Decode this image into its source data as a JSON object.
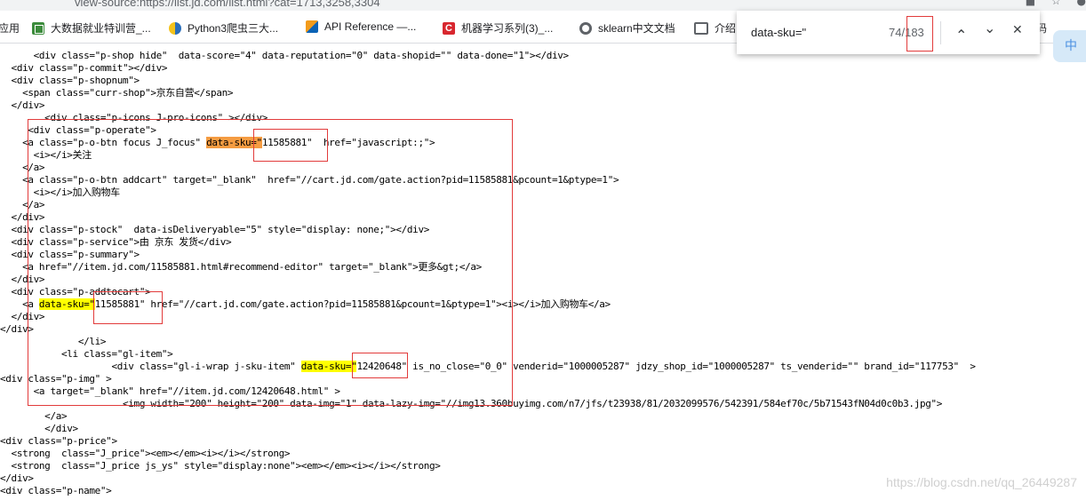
{
  "browser": {
    "url": "view-source:https://list.jd.com/list.html?cat=1713,3258,3304",
    "icons": {
      "extension": "extension-icon",
      "star": "star-icon",
      "profile": "profile-icon"
    }
  },
  "bookmarks": [
    {
      "label": "应用",
      "icon": "apps-icon"
    },
    {
      "label": "大数据就业特训营_...",
      "icon": "green-site-icon"
    },
    {
      "label": "Python3爬虫三大...",
      "icon": "python-icon"
    },
    {
      "label": "API Reference —...",
      "icon": "api-icon"
    },
    {
      "label": "机器学习系列(3)_...",
      "icon": "csdn-icon",
      "glyph": "C"
    },
    {
      "label": "sklearn中文文档",
      "icon": "globe-icon"
    },
    {
      "label": "介绍",
      "icon": "book-icon"
    }
  ],
  "bookmarks_tail": "码",
  "side_tab": "中",
  "find_bar": {
    "query": "data-sku=\"",
    "current": "74",
    "total": "183",
    "separator": "/",
    "prev_glyph": "⌃",
    "next_glyph": "⌄",
    "close_glyph": "✕"
  },
  "source_lines": [
    {
      "t": "      <div class=\"p-shop hide\"  data-score=\"4\" data-reputation=\"0\" data-shopid=\"\" data-done=\"1\"></div>"
    },
    {
      "t": "  <div class=\"p-commit\"></div>"
    },
    {
      "t": "  <div class=\"p-shopnum\">"
    },
    {
      "t": "    <span class=\"curr-shop\">京东自营</span>"
    },
    {
      "t": "  </div>"
    },
    {
      "t": "        <div class=\"p-icons J-pro-icons\" ></div>"
    },
    {
      "t": "     <div class=\"p-operate\">"
    },
    {
      "pre": "    <a class=\"p-o-btn focus J_focus\" ",
      "hl": "data-sku=\"",
      "hlcolor": "orange",
      "post": "11585881\"  href=\"javascript:;\">"
    },
    {
      "t": "      <i></i>关注"
    },
    {
      "t": "    </a>"
    },
    {
      "t": "    <a class=\"p-o-btn addcart\" target=\"_blank\"  href=\"//cart.jd.com/gate.action?pid=11585881&pcount=1&ptype=1\">"
    },
    {
      "t": "      <i></i>加入购物车"
    },
    {
      "t": "    </a>"
    },
    {
      "t": "  </div>"
    },
    {
      "t": "  <div class=\"p-stock\"  data-isDeliveryable=\"5\" style=\"display: none;\"></div>"
    },
    {
      "t": "  <div class=\"p-service\">由 京东 发货</div>"
    },
    {
      "t": "  <div class=\"p-summary\">"
    },
    {
      "t": "    <a href=\"//item.jd.com/11585881.html#recommend-editor\" target=\"_blank\">更多&gt;</a>"
    },
    {
      "t": "  </div>"
    },
    {
      "t": "  <div class=\"p-addtocart\">"
    },
    {
      "pre": "    <a ",
      "hl": "data-sku=\"",
      "hlcolor": "yellow",
      "post": "11585881\" href=\"//cart.jd.com/gate.action?pid=11585881&pcount=1&ptype=1\"><i></i>加入购物车</a>"
    },
    {
      "t": "  </div>"
    },
    {
      "t": "</div>"
    },
    {
      "t": "              </li>"
    },
    {
      "t": "           <li class=\"gl-item\">"
    },
    {
      "pre": "                    <div class=\"gl-i-wrap j-sku-item\" ",
      "hl": "data-sku=\"",
      "hlcolor": "yellow",
      "post": "12420648\" is_no_close=\"0_0\" venderid=\"1000005287\" jdzy_shop_id=\"1000005287\" ts_venderid=\"\" brand_id=\"117753\"  >"
    },
    {
      "t": "<div class=\"p-img\" >"
    },
    {
      "t": "      <a target=\"_blank\" href=\"//item.jd.com/12420648.html\" >"
    },
    {
      "t": "                      <img width=\"200\" height=\"200\" data-img=\"1\" data-lazy-img=\"//img13.360buyimg.com/n7/jfs/t23938/81/2032099576/542391/584ef70c/5b71543fN04d0c0b3.jpg\">"
    },
    {
      "t": "        </a>"
    },
    {
      "t": "        </div>"
    },
    {
      "t": "<div class=\"p-price\">"
    },
    {
      "t": "  <strong  class=\"J_price\"><em></em><i></i></strong>"
    },
    {
      "t": "  <strong  class=\"J_price js_ys\" style=\"display:none\"><em></em><i></i></strong>"
    },
    {
      "t": "</div>"
    },
    {
      "t": "<div class=\"p-name\">"
    }
  ],
  "watermark": "https://blog.csdn.net/qq_26449287",
  "colors": {
    "annotation_red": "#e23b3b",
    "highlight_current": "#f59c42",
    "highlight_match": "#ffff00"
  }
}
